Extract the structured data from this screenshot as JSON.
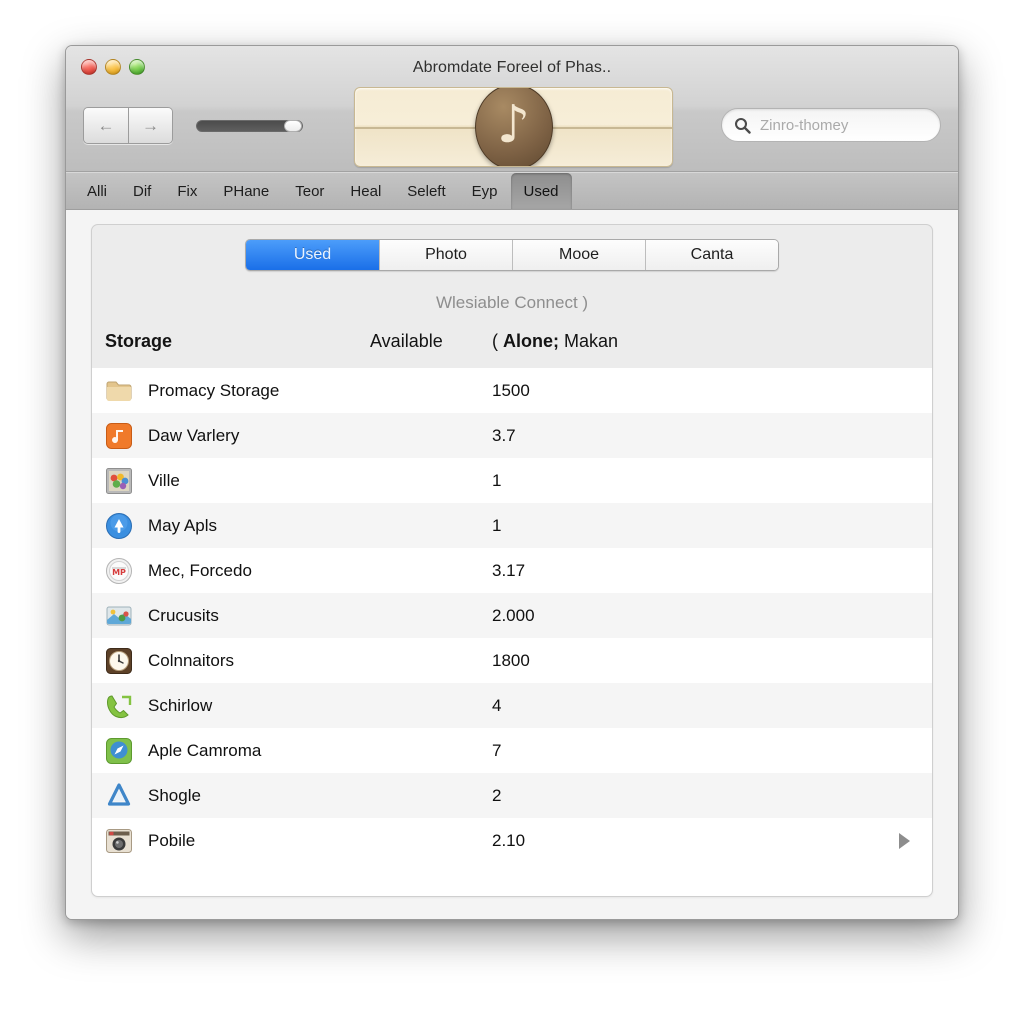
{
  "window": {
    "title": "Abromdate Foreel of Phas..",
    "traffic_lights": [
      "close-red",
      "minimize-yellow",
      "zoom-green"
    ]
  },
  "toolbar": {
    "back_icon": "left-arrow-icon",
    "forward_icon": "right-arrow-icon",
    "back_glyph": "←",
    "forward_glyph": "→",
    "slider_name": "volume-slider",
    "display_note_glyph": "♪",
    "search": {
      "icon": "search-icon",
      "placeholder": "Zinro-thomey",
      "value": ""
    }
  },
  "menu": {
    "items": [
      {
        "label": "Alli",
        "active": false
      },
      {
        "label": "Dif",
        "active": false
      },
      {
        "label": "Fix",
        "active": false
      },
      {
        "label": "PHane",
        "active": false
      },
      {
        "label": "Teor",
        "active": false
      },
      {
        "label": "Heal",
        "active": false
      },
      {
        "label": "Seleft",
        "active": false
      },
      {
        "label": "Eyp",
        "active": false
      },
      {
        "label": "Used",
        "active": true
      }
    ]
  },
  "segmented": {
    "options": [
      {
        "label": "Used",
        "active": true
      },
      {
        "label": "Photo",
        "active": false
      },
      {
        "label": "Mooe",
        "active": false
      },
      {
        "label": "Canta",
        "active": false
      }
    ],
    "accent_color": "#1a6fe8"
  },
  "panel": {
    "subtitle": "Wlesiable Connect )",
    "columns": {
      "name": "Storage",
      "available": "Available",
      "extra_prefix": "( ",
      "extra_bold": "Alone;",
      "extra_rest": " Makan"
    },
    "rows": [
      {
        "icon": "folder-icon",
        "label": "Promacy Storage",
        "value": "1500"
      },
      {
        "icon": "music-library-icon",
        "label": "Daw Varlery",
        "value": "3.7"
      },
      {
        "icon": "photos-album-icon",
        "label": "Ville",
        "value": "1"
      },
      {
        "icon": "app-store-icon",
        "label": "May Apls",
        "value": "1"
      },
      {
        "icon": "gauge-icon",
        "label": "Mec, Forcedo",
        "value": "3.17"
      },
      {
        "icon": "postcard-icon",
        "label": "Crucusits",
        "value": "2.000"
      },
      {
        "icon": "clock-icon",
        "label": "Colnnaitors",
        "value": "1800"
      },
      {
        "icon": "phone-icon",
        "label": "Schirlow",
        "value": "4"
      },
      {
        "icon": "compass-icon",
        "label": "Aple Camroma",
        "value": "7"
      },
      {
        "icon": "recycle-icon",
        "label": "Shogle",
        "value": "2"
      },
      {
        "icon": "camera-icon",
        "label": "Pobile",
        "value": "2.10"
      }
    ],
    "disclosure_row_index": 10
  }
}
